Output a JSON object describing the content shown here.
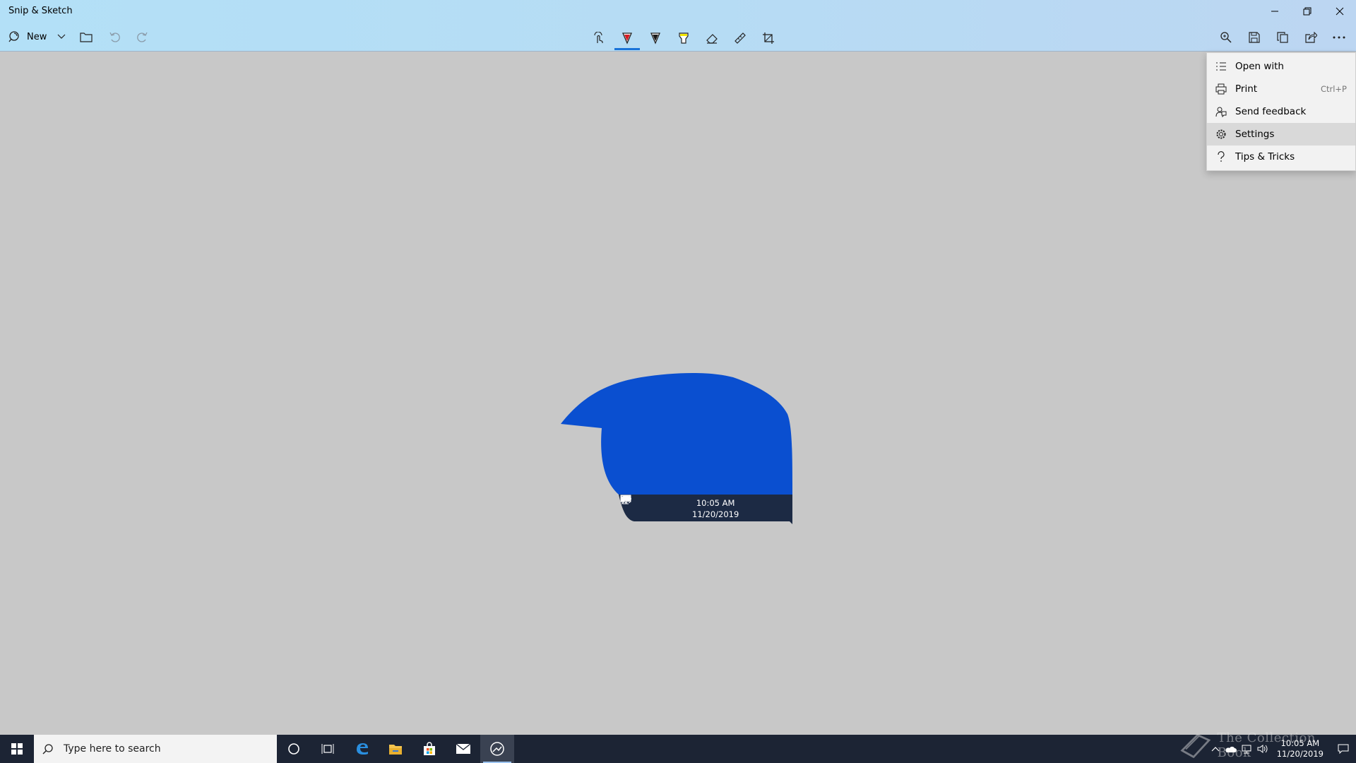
{
  "window": {
    "title": "Snip & Sketch",
    "controls": {
      "minimize": "—",
      "restore": "❐",
      "close": "✕"
    }
  },
  "toolbar": {
    "new_label": "New",
    "left_icons": [
      "new-snip-icon",
      "chevron-down-icon",
      "open-folder-icon",
      "undo-icon",
      "redo-icon"
    ],
    "center_icons": [
      "touch-writing-icon",
      "ballpoint-pen-icon",
      "pencil-icon",
      "highlighter-icon",
      "eraser-icon",
      "ruler-icon",
      "crop-icon"
    ],
    "right_icons": [
      "zoom-icon",
      "save-icon",
      "copy-icon",
      "share-icon",
      "more-icon"
    ],
    "active_tool": "ballpoint-pen-icon",
    "pen_color": "#d81b24",
    "pencil_color": "#1a1a1a",
    "highlighter_color": "#f2e600",
    "accent_color": "#1a73d8"
  },
  "menu": {
    "items": [
      {
        "label": "Open with",
        "icon": "open-with-icon",
        "shortcut": ""
      },
      {
        "label": "Print",
        "icon": "print-icon",
        "shortcut": "Ctrl+P"
      },
      {
        "label": "Send feedback",
        "icon": "feedback-icon",
        "shortcut": ""
      },
      {
        "label": "Settings",
        "icon": "gear-icon",
        "shortcut": ""
      },
      {
        "label": "Tips & Tricks",
        "icon": "question-icon",
        "shortcut": ""
      }
    ],
    "hovered": "Settings"
  },
  "snip": {
    "fill_color": "#0a4fd0",
    "taskbar_color": "#1c2a44",
    "time": "10:05 AM",
    "date": "11/20/2019"
  },
  "taskbar": {
    "search_placeholder": "Type here to search",
    "time": "10:05 AM",
    "date": "11/20/2019",
    "apps": [
      "cortana-icon",
      "task-view-icon",
      "edge-icon",
      "file-explorer-icon",
      "store-icon",
      "mail-icon",
      "snip-sketch-icon"
    ],
    "active_app": "snip-sketch-icon"
  },
  "watermark": {
    "text": "The Collection Book"
  }
}
